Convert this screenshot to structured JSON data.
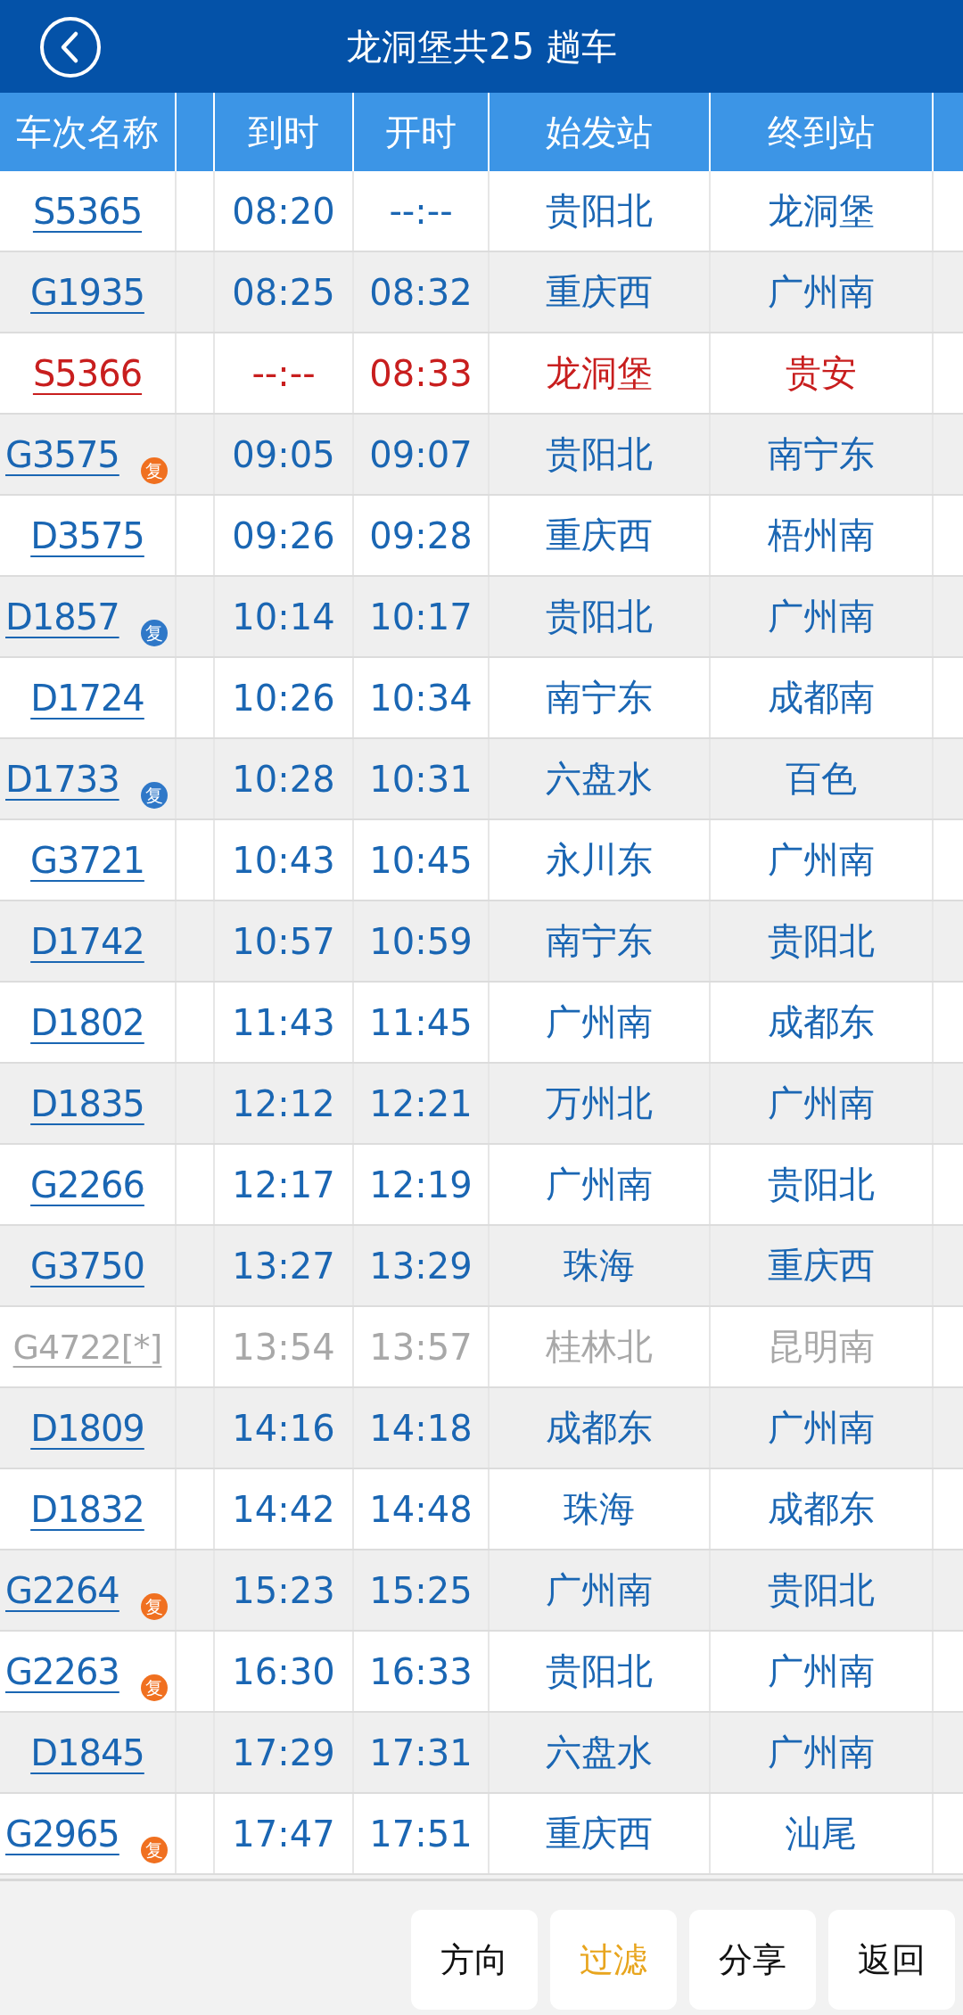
{
  "header": {
    "title": "龙洞堡共25 趟车"
  },
  "columns": [
    "车次名称",
    "到时",
    "开时",
    "始发站",
    "终到站"
  ],
  "rows": [
    {
      "kind": "normal",
      "train": "S5365",
      "arrive": "08:20",
      "depart": "--:--",
      "origin": "贵阳北",
      "terminus": "龙洞堡"
    },
    {
      "kind": "normal",
      "train": "G1935",
      "arrive": "08:25",
      "depart": "08:32",
      "origin": "重庆西",
      "terminus": "广州南"
    },
    {
      "kind": "highlight",
      "train": "S5366",
      "arrive": "--:--",
      "depart": "08:33",
      "origin": "龙洞堡",
      "terminus": "贵安"
    },
    {
      "kind": "normal",
      "train": "G3575",
      "badge": {
        "text": "复",
        "color": "#f07020"
      },
      "arrive": "09:05",
      "depart": "09:07",
      "origin": "贵阳北",
      "terminus": "南宁东"
    },
    {
      "kind": "normal",
      "train": "D3575",
      "arrive": "09:26",
      "depart": "09:28",
      "origin": "重庆西",
      "terminus": "梧州南"
    },
    {
      "kind": "normal",
      "train": "D1857",
      "badge": {
        "text": "复",
        "color": "#2f78c8"
      },
      "arrive": "10:14",
      "depart": "10:17",
      "origin": "贵阳北",
      "terminus": "广州南"
    },
    {
      "kind": "normal",
      "train": "D1724",
      "arrive": "10:26",
      "depart": "10:34",
      "origin": "南宁东",
      "terminus": "成都南"
    },
    {
      "kind": "normal",
      "train": "D1733",
      "badge": {
        "text": "复",
        "color": "#2f78c8"
      },
      "arrive": "10:28",
      "depart": "10:31",
      "origin": "六盘水",
      "terminus": "百色"
    },
    {
      "kind": "normal",
      "train": "G3721",
      "arrive": "10:43",
      "depart": "10:45",
      "origin": "永川东",
      "terminus": "广州南"
    },
    {
      "kind": "normal",
      "train": "D1742",
      "arrive": "10:57",
      "depart": "10:59",
      "origin": "南宁东",
      "terminus": "贵阳北"
    },
    {
      "kind": "normal",
      "train": "D1802",
      "arrive": "11:43",
      "depart": "11:45",
      "origin": "广州南",
      "terminus": "成都东"
    },
    {
      "kind": "normal",
      "train": "D1835",
      "arrive": "12:12",
      "depart": "12:21",
      "origin": "万州北",
      "terminus": "广州南"
    },
    {
      "kind": "normal",
      "train": "G2266",
      "arrive": "12:17",
      "depart": "12:19",
      "origin": "广州南",
      "terminus": "贵阳北"
    },
    {
      "kind": "normal",
      "train": "G3750",
      "arrive": "13:27",
      "depart": "13:29",
      "origin": "珠海",
      "terminus": "重庆西"
    },
    {
      "kind": "disabled",
      "train": "G4722[*]",
      "arrive": "13:54",
      "depart": "13:57",
      "origin": "桂林北",
      "terminus": "昆明南"
    },
    {
      "kind": "normal",
      "train": "D1809",
      "arrive": "14:16",
      "depart": "14:18",
      "origin": "成都东",
      "terminus": "广州南"
    },
    {
      "kind": "normal",
      "train": "D1832",
      "arrive": "14:42",
      "depart": "14:48",
      "origin": "珠海",
      "terminus": "成都东"
    },
    {
      "kind": "normal",
      "train": "G2264",
      "badge": {
        "text": "复",
        "color": "#f07020"
      },
      "arrive": "15:23",
      "depart": "15:25",
      "origin": "广州南",
      "terminus": "贵阳北"
    },
    {
      "kind": "normal",
      "train": "G2263",
      "badge": {
        "text": "复",
        "color": "#f07020"
      },
      "arrive": "16:30",
      "depart": "16:33",
      "origin": "贵阳北",
      "terminus": "广州南"
    },
    {
      "kind": "normal",
      "train": "D1845",
      "arrive": "17:29",
      "depart": "17:31",
      "origin": "六盘水",
      "terminus": "广州南"
    },
    {
      "kind": "normal",
      "train": "G2965",
      "badge": {
        "text": "复",
        "color": "#f07020"
      },
      "arrive": "17:47",
      "depart": "17:51",
      "origin": "重庆西",
      "terminus": "汕尾"
    }
  ],
  "buttons": [
    {
      "label": "方向",
      "active": false
    },
    {
      "label": "过滤",
      "active": true
    },
    {
      "label": "分享",
      "active": false
    },
    {
      "label": "返回",
      "active": false
    }
  ]
}
